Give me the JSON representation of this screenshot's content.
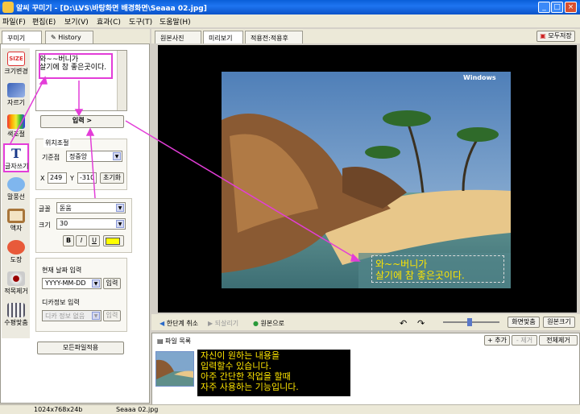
{
  "window": {
    "title": "알씨 꾸미기 - [D:\\LVS\\바탕화면 배경화면\\Seaaa 02.jpg]",
    "min": "_",
    "max": "□",
    "close": "×"
  },
  "menu": [
    "파일(F)",
    "편집(E)",
    "보기(V)",
    "효과(C)",
    "도구(T)",
    "도움말(H)"
  ],
  "left_tabs": [
    "꾸미기",
    "History"
  ],
  "tools": [
    "크기변경",
    "자르기",
    "색조절",
    "글자쓰기",
    "말풍선",
    "액자",
    "도장",
    "적목제거",
    "수평맞춤"
  ],
  "tool_badge": "SIZE",
  "editor": {
    "line1": "와~~버니가",
    "line2": "살기에 참 좋은곳이다."
  },
  "input_button": "입력 >",
  "position": {
    "legend": "위치조절",
    "anchor_label": "기준점",
    "anchor_value": "정중앙",
    "x_label": "X",
    "x_value": "249",
    "y_label": "Y",
    "y_value": "-310",
    "reset": "초기화"
  },
  "font": {
    "font_label": "글꼴",
    "font_value": "돋움",
    "size_label": "크기",
    "size_value": "30",
    "bold": "B",
    "italic": "I",
    "underline": "U",
    "color": "#ffff00"
  },
  "date": {
    "label": "현재 날짜 입력",
    "format": "YYYY-MM-DD",
    "input": "입력"
  },
  "camera": {
    "label": "디카정보 입력",
    "placeholder": "디카 정보 없음",
    "input": "입력"
  },
  "apply_all": "모든파일적용",
  "right_tabs": [
    "원본사진",
    "미리보기",
    "적용전:적용후"
  ],
  "save_all": "모두저장",
  "photo": {
    "watermark": "Windows",
    "line1": "와~~버니가",
    "line2": "살기에 참 좋은곳이다."
  },
  "bottombar": {
    "undo": "한단계 취소",
    "redo": "되살리기",
    "original": "원본으로",
    "fit": "화면맞춤",
    "actual": "원본크기"
  },
  "filelist": {
    "title": "파일 목록",
    "add": "+ 추가",
    "remove": "- 제거",
    "remove_all": "전체제거",
    "caption": [
      "자신이 원하는 내용을",
      "입력할수 있습니다.",
      "아주 간단한 작업을 할때",
      "자주 사용하는 기능입니다."
    ]
  },
  "status": {
    "dimensions": "1024x768x24b",
    "filename": "Seaaa 02.jpg"
  },
  "colors": {
    "magenta": "#e33dd8",
    "title_blue": "#0a5fd8",
    "overlay_yellow": "#ffe600",
    "caption_bg": "#000000",
    "caption_fg": "#ffe600"
  }
}
